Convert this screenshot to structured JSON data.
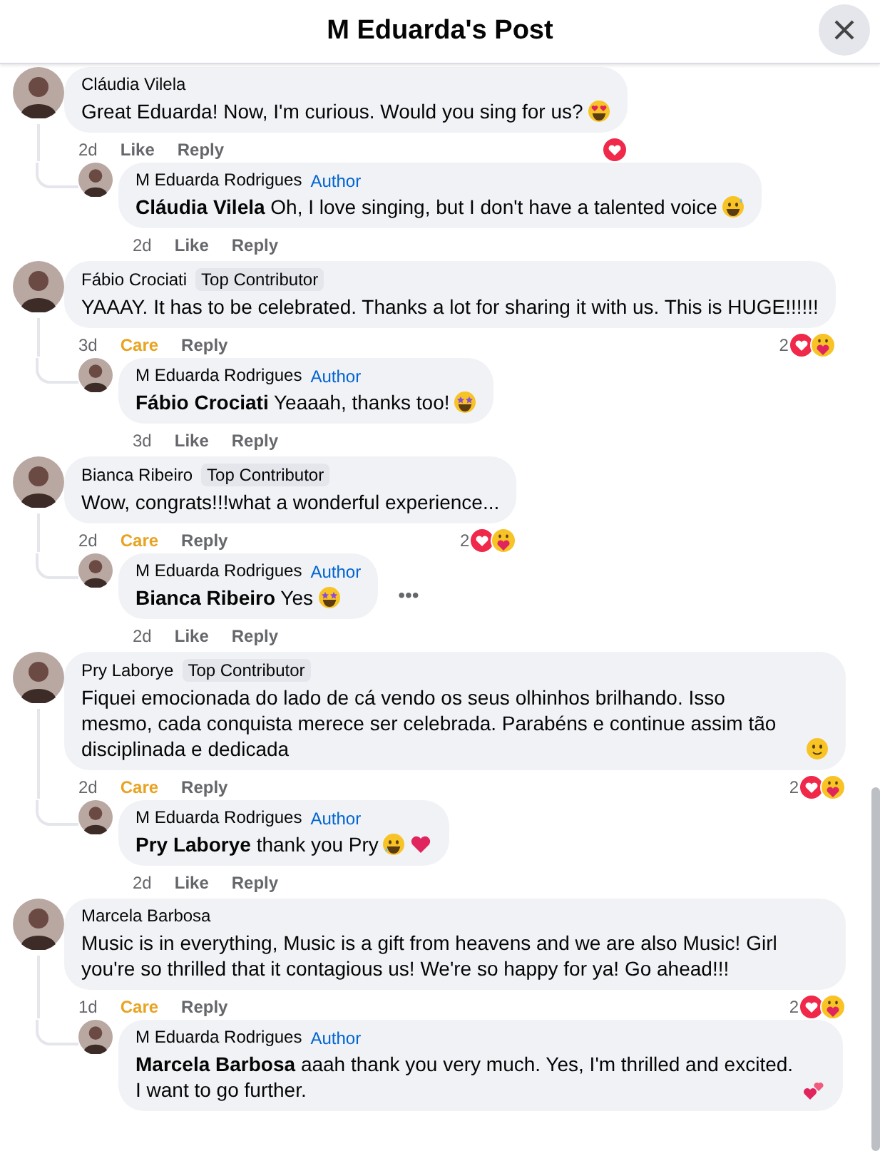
{
  "header": {
    "title": "M Eduarda's Post"
  },
  "threads": [
    {
      "comment": {
        "author": "Cláudia Vilela",
        "text": "Great Eduarda! Now, I'm curious. Would you sing for us?",
        "emoji": [
          {
            "kind": "heart-eyes"
          }
        ],
        "time": "2d",
        "reaction": {
          "label": "Like",
          "reacted": false
        },
        "reply_label": "Reply",
        "summary": {
          "icons": [
            {
              "kind": "love"
            }
          ]
        }
      },
      "reply": {
        "author": "M Eduarda Rodrigues",
        "badge": {
          "label": "Author",
          "kind": "author"
        },
        "text": "**Cláudia Vilela** Oh, I love singing, but I don't have a talented voice",
        "emoji": [
          {
            "kind": "sweat-smile"
          }
        ],
        "time": "2d",
        "reaction": {
          "label": "Like",
          "reacted": false
        },
        "reply_label": "Reply"
      }
    },
    {
      "comment": {
        "author": "Fábio Crociati",
        "badge": {
          "label": "Top Contributor",
          "kind": "contributor"
        },
        "text": "YAAAY. It has to be celebrated. Thanks a lot for sharing it with us. This is HUGE!!!!!!",
        "time": "3d",
        "reaction": {
          "label": "Care",
          "reacted": true
        },
        "reply_label": "Reply",
        "summary": {
          "count": "2",
          "icons": [
            {
              "kind": "love"
            },
            {
              "kind": "care"
            }
          ]
        }
      },
      "reply": {
        "author": "M Eduarda Rodrigues",
        "badge": {
          "label": "Author",
          "kind": "author"
        },
        "text": "**Fábio Crociati** Yeaaah, thanks too!",
        "emoji": [
          {
            "kind": "star-struck"
          }
        ],
        "time": "3d",
        "reaction": {
          "label": "Like",
          "reacted": false
        },
        "reply_label": "Reply"
      }
    },
    {
      "comment": {
        "author": "Bianca Ribeiro",
        "badge": {
          "label": "Top Contributor",
          "kind": "contributor"
        },
        "text": "Wow, congrats!!!what a wonderful experience...",
        "time": "2d",
        "reaction": {
          "label": "Care",
          "reacted": true
        },
        "reply_label": "Reply",
        "summary": {
          "count": "2",
          "icons": [
            {
              "kind": "love"
            },
            {
              "kind": "care"
            }
          ]
        }
      },
      "reply": {
        "author": "M Eduarda Rodrigues",
        "badge": {
          "label": "Author",
          "kind": "author"
        },
        "text": "**Bianca Ribeiro** Yes",
        "emoji": [
          {
            "kind": "star-struck"
          }
        ],
        "time": "2d",
        "reaction": {
          "label": "Like",
          "reacted": false
        },
        "reply_label": "Reply",
        "more": "•••"
      }
    },
    {
      "comment": {
        "author": "Pry Laborye",
        "badge": {
          "label": "Top Contributor",
          "kind": "contributor"
        },
        "text": "Fiquei emocionada do lado de cá vendo os seus olhinhos brilhando. Isso mesmo, cada conquista merece ser celebrada. Parabéns e continue assim tão disciplinada e dedicada",
        "emoji": [
          {
            "kind": "smile"
          }
        ],
        "time": "2d",
        "reaction": {
          "label": "Care",
          "reacted": true
        },
        "reply_label": "Reply",
        "summary": {
          "count": "2",
          "icons": [
            {
              "kind": "love"
            },
            {
              "kind": "care"
            }
          ]
        }
      },
      "reply": {
        "author": "M Eduarda Rodrigues",
        "badge": {
          "label": "Author",
          "kind": "author"
        },
        "text": "**Pry Laborye** thank you Pry",
        "emoji": [
          {
            "kind": "tear"
          },
          {
            "kind": "heart"
          }
        ],
        "time": "2d",
        "reaction": {
          "label": "Like",
          "reacted": false
        },
        "reply_label": "Reply"
      }
    },
    {
      "comment": {
        "author": "Marcela Barbosa",
        "text": "Music is in everything, Music is a gift from heavens and we are also Music! Girl you're so thrilled that it contagious us! We're so happy for ya! Go ahead!!!",
        "time": "1d",
        "reaction": {
          "label": "Care",
          "reacted": true
        },
        "reply_label": "Reply",
        "summary": {
          "count": "2",
          "icons": [
            {
              "kind": "love"
            },
            {
              "kind": "care"
            }
          ]
        }
      },
      "reply": {
        "author": "M Eduarda Rodrigues",
        "badge": {
          "label": "Author",
          "kind": "author"
        },
        "text": "**Marcela Barbosa** aaah thank you very much. Yes, I'm thrilled and excited. I want to go further.",
        "emoji": [
          {
            "kind": "two-hearts"
          }
        ]
      }
    }
  ]
}
